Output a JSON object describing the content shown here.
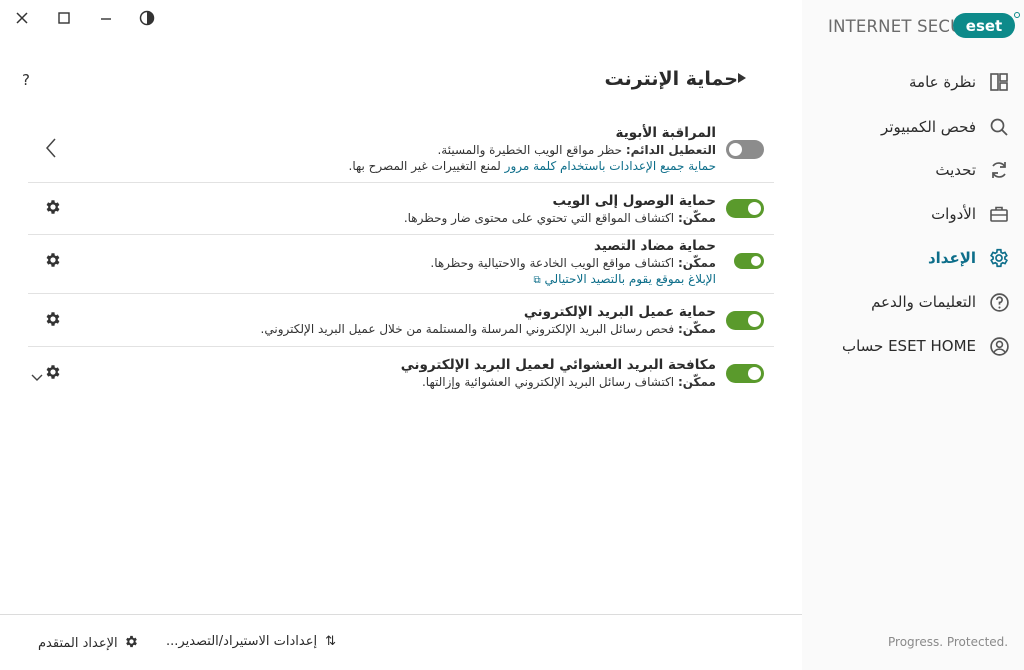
{
  "window": {
    "close_icon": "close-icon",
    "maximize_icon": "maximize-icon",
    "minimize_icon": "minimize-icon",
    "theme_icon": "contrast-icon"
  },
  "brand": {
    "logo_text": "eset",
    "product": "INTERNET SECURITY",
    "accent": "#0d8a8a"
  },
  "header": {
    "help": "?",
    "title": "حماية الإنترنت"
  },
  "rows": [
    {
      "title": "المراقبة الأبوية",
      "desc_bold": "التعطيل الدائم:",
      "desc": " حظر مواقع الويب الخطيرة والمسيئة.",
      "link": "حماية جميع الإعدادات باستخدام كلمة مرور",
      "link_tail": " لمنع التغييرات غير المصرح بها.",
      "enabled": false
    },
    {
      "title": "حماية الوصول إلى الويب",
      "desc_bold": "ممكّن:",
      "desc": " اكتشاف المواقع التي تحتوي على محتوى ضار وحظرها.",
      "enabled": true
    },
    {
      "title": "حماية مضاد التصيد",
      "desc_bold": "ممكّن:",
      "desc": " اكتشاف مواقع الويب الخادعة والاحتيالية وحظرها.",
      "link": "الإبلاغ بموقع يقوم بالتصيد الاحتيالي",
      "enabled": true
    },
    {
      "title": "حماية عميل البريد الإلكتروني",
      "desc_bold": "ممكّن:",
      "desc": " فحص رسائل البريد الإلكتروني المرسلة والمستلمة من خلال عميل البريد الإلكتروني.",
      "enabled": true
    },
    {
      "title": "مكافحة البريد العشوائي لعميل البريد الإلكتروني",
      "desc_bold": "ممكّن:",
      "desc": " اكتشاف رسائل البريد الإلكتروني العشوائية وإزالتها.",
      "enabled": true
    }
  ],
  "footer": {
    "import_export": "إعدادات الاستيراد/التصدير...",
    "advanced": "الإعداد المتقدم"
  },
  "sidebar": {
    "items": [
      {
        "label": "نظرة عامة",
        "icon": "dashboard-icon",
        "active": false
      },
      {
        "label": "فحص الكمبيوتر",
        "icon": "search-icon",
        "active": false
      },
      {
        "label": "تحديث",
        "icon": "refresh-icon",
        "active": false
      },
      {
        "label": "الأدوات",
        "icon": "briefcase-icon",
        "active": false
      },
      {
        "label": "الإعداد",
        "icon": "gear-icon",
        "active": true
      },
      {
        "label": "التعليمات والدعم",
        "icon": "help-icon",
        "active": false
      },
      {
        "label": "حساب ESET HOME",
        "icon": "account-icon",
        "active": false
      }
    ],
    "tagline": "Progress. Protected."
  },
  "colors": {
    "toggle_on": "#5a9a2c",
    "toggle_off": "#8c8c8c",
    "link": "#0d6e8a",
    "active_nav": "#0d6e8a"
  }
}
